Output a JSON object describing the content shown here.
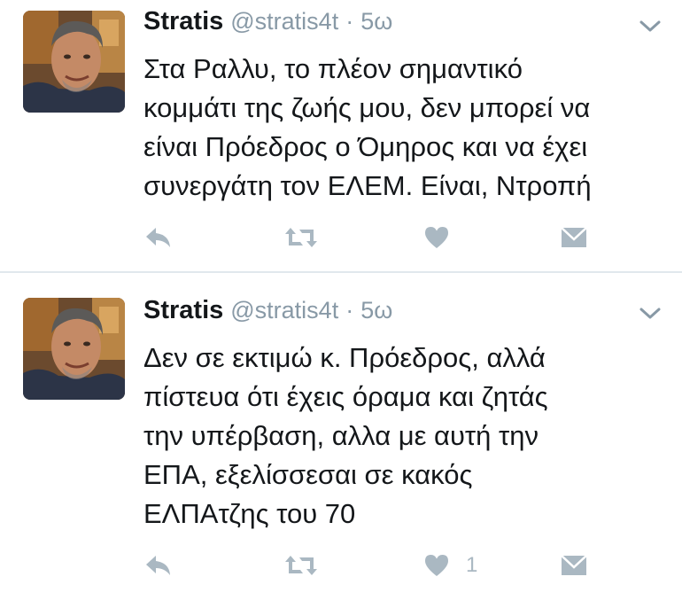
{
  "tweets": [
    {
      "user": {
        "name": "Stratis",
        "handle": "@stratis4t"
      },
      "separator": "·",
      "time": "5ω",
      "text_lines": [
        "Στα Ραλλυ, το πλέον σημαντικό",
        "κομμάτι της ζωής μου, δεν μπορεί να",
        "είναι Πρόεδρος ο Όμηρος και να έχει",
        "συνεργάτη τον ΕΛΕΜ. Είναι, Ντροπή"
      ],
      "like_count": ""
    },
    {
      "user": {
        "name": "Stratis",
        "handle": "@stratis4t"
      },
      "separator": "·",
      "time": "5ω",
      "text_lines": [
        "Δεν σε εκτιμώ κ. Πρόεδρος, αλλά",
        "πίστευα ότι έχεις όραμα και ζητάς",
        "την υπέρβαση, αλλα με αυτή την",
        "ΕΠΑ, εξελίσσεσαι σε κακός",
        "ΕΛΠΑτζης του 70"
      ],
      "like_count": "1"
    }
  ],
  "icons": {
    "reply": "reply-icon",
    "retweet": "retweet-icon",
    "like": "heart-icon",
    "dm": "direct-message-icon",
    "menu": "chevron-down-icon"
  },
  "colors": {
    "text": "#14171a",
    "secondary": "#8899a6",
    "action_icon": "#aab8c2",
    "divider": "#e1e8ed"
  }
}
